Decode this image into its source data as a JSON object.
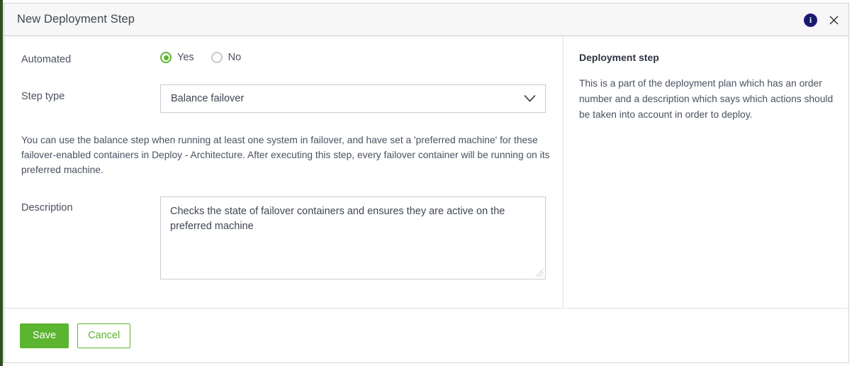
{
  "dialog": {
    "title": "New Deployment Step",
    "info_icon_glyph": "i",
    "info_icon_name": "info-icon",
    "close_icon_name": "close-icon"
  },
  "form": {
    "automated": {
      "label": "Automated",
      "options": [
        {
          "label": "Yes",
          "selected": true
        },
        {
          "label": "No",
          "selected": false
        }
      ]
    },
    "step_type": {
      "label": "Step type",
      "value": "Balance failover"
    },
    "helper_text": "You can use the balance step when running at least one system in failover, and have set a 'preferred machine' for these failover-enabled containers in Deploy - Architecture. After executing this step, every failover container will be running on its preferred machine.",
    "description": {
      "label": "Description",
      "value": "Checks the state of failover containers and ensures they are active on the preferred machine"
    }
  },
  "info_panel": {
    "title": "Deployment step",
    "text": "This is a part of the deployment plan which has an order number and a description which says which actions should be taken into account in order to deploy."
  },
  "footer": {
    "save_label": "Save",
    "cancel_label": "Cancel"
  },
  "colors": {
    "accent_green": "#5cb531",
    "info_blue": "#151c6e",
    "header_bg": "#f7f7f7",
    "border": "#c7ccd2"
  }
}
